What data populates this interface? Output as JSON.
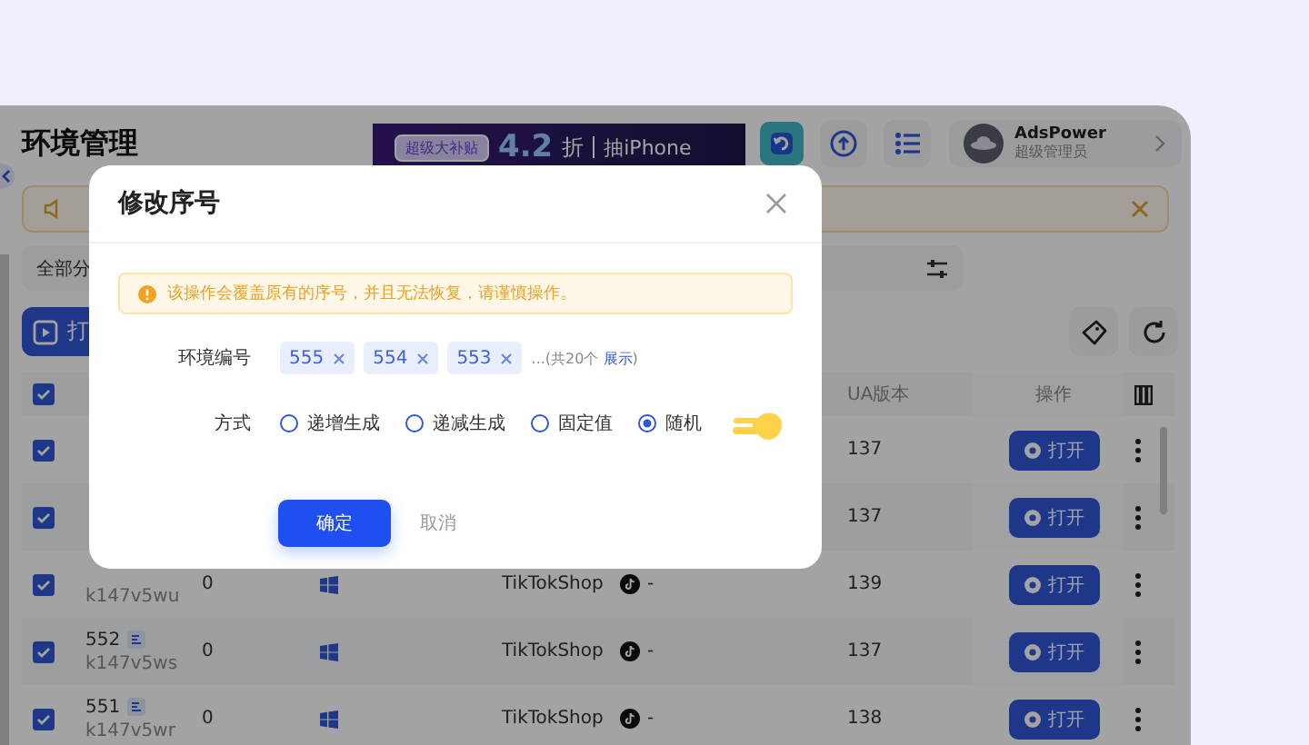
{
  "header": {
    "title": "环境管理",
    "promo": {
      "badge": "超级大补贴",
      "discount": "4.2",
      "unit": "折",
      "prize": "抽iPhone"
    },
    "user": {
      "name": "AdsPower",
      "role": "超级管理员"
    }
  },
  "filter": {
    "group_label": "全部分"
  },
  "toolbar": {
    "open_label": "打"
  },
  "table": {
    "all_checked": true,
    "columns": [
      {
        "label": "UA版本"
      },
      {
        "label": "操作"
      }
    ],
    "rows": [
      {
        "checked": true,
        "ua": "137",
        "action": "打开"
      },
      {
        "checked": true,
        "ua": "137",
        "action": "打开"
      },
      {
        "checked": true,
        "code": "k147v5wu",
        "column_3": "0",
        "platform": "TikTokShop",
        "column_6": "-",
        "ua": "139",
        "action": "打开"
      },
      {
        "checked": true,
        "id": "552",
        "code": "k147v5ws",
        "column_3": "0",
        "platform": "TikTokShop",
        "column_6": "-",
        "ua": "137",
        "action": "打开"
      },
      {
        "checked": true,
        "id": "551",
        "code": "k147v5wr",
        "column_3": "0",
        "platform": "TikTokShop",
        "column_6": "-",
        "ua": "138",
        "action": "打开"
      }
    ]
  },
  "dialog": {
    "title": "修改序号",
    "warning": "该操作会覆盖原有的序号，并且无法恢复，请谨慎操作。",
    "ids_label": "环境编号",
    "tags": [
      "555",
      "554",
      "553"
    ],
    "more": {
      "before": "...(共20个 ",
      "link": "展示",
      "after": ")"
    },
    "mode_label": "方式",
    "modes": [
      {
        "label": "递增生成",
        "selected": false
      },
      {
        "label": "递减生成",
        "selected": false
      },
      {
        "label": "固定值",
        "selected": false
      },
      {
        "label": "随机",
        "selected": true
      }
    ],
    "confirm": "确定",
    "cancel": "取消"
  }
}
